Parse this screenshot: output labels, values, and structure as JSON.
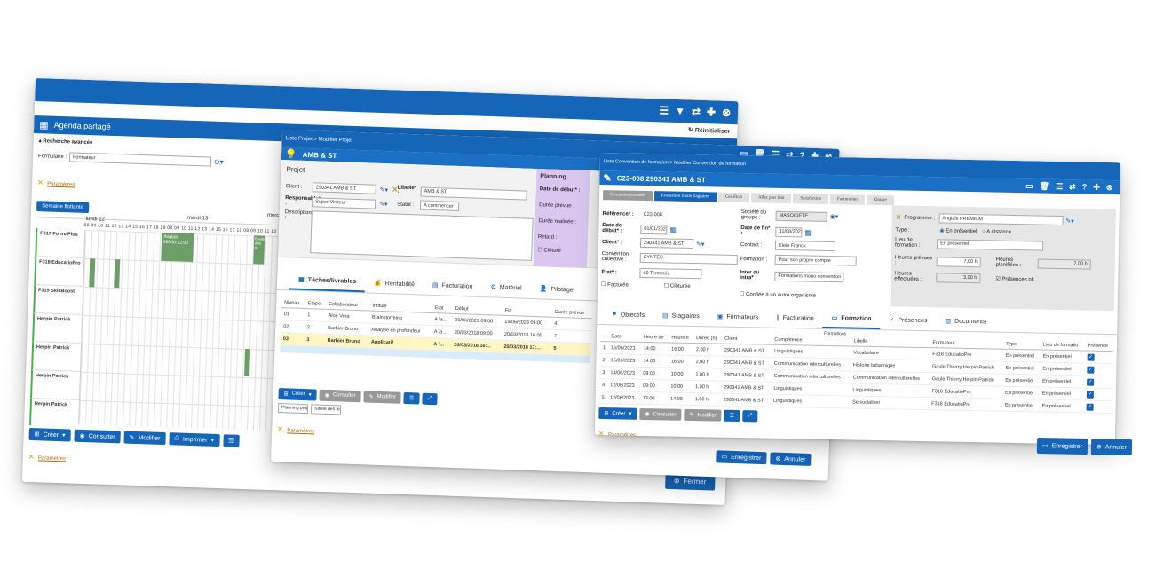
{
  "agenda": {
    "title": "Agenda partagé",
    "reset_label": "Réinitialiser",
    "advanced_search": "Recherche avancée",
    "form_label": "Formulaire :",
    "form_value": "Formateur",
    "params_label": "Paramètres",
    "week_btn": "Semaine flottante",
    "days": [
      "lundi 12",
      "mardi 13",
      "merc"
    ],
    "hours": "08 09 10 11 12 13 14 15 16 17 18 19 08 09 10 11 12 13 14 15 16 17 18 08 09 10 11 12",
    "rows": [
      "F317 FormaPlus",
      "F318 EducatioPro",
      "F319 SkillBoost",
      "Herpin Patrick",
      "Herpin Patrick",
      "Herpin Patrick",
      "Herpin Patrick"
    ],
    "event1": "Anglais 08h00-12:00",
    "event2": "Evalu atio n",
    "buttons": [
      "Créer",
      "Consulter",
      "Modifier",
      "Imprimer"
    ],
    "close_label": "Fermer"
  },
  "projet": {
    "breadcrumb": "Liste Projet > Modifier Projet",
    "title": "AMB & ST",
    "section": "Projet",
    "client_label": "Client :",
    "client_value": "290341 AMB & ST",
    "libelle_label": "Libellé* :",
    "libelle_value": "AMB & ST",
    "resp_label": "Responsable* :",
    "resp_value": "Super Visiteur",
    "statut_label": "Statut :",
    "statut_value": "A commencer",
    "desc_label": "Description :",
    "planning_title": "Planning",
    "date_debut_label": "Date de début* :",
    "date_debut_value": "09/06/2",
    "duree_prevue": "Durée prévue :",
    "duree_realisee": "Durée réalisée :",
    "retard": "Retard :",
    "cloture": "Clôturé",
    "tabs": [
      "Tâches/livrables",
      "Rentabilité",
      "Facturation",
      "Matériel",
      "Pilotage"
    ],
    "a_faire": "A faire",
    "cols": [
      "Niveau",
      "Etape",
      "Collaborateur",
      "Intitulé",
      "Etat",
      "Début",
      "Fin",
      "Durée prévue"
    ],
    "rows": [
      [
        "01",
        "1",
        "Aloé Vera",
        "Brainstorming",
        "A fa...",
        "09/06/2023 09:00",
        "19/06/2023 09:00",
        "4"
      ],
      [
        "02",
        "2",
        "Barbier Bruno",
        "Analyse en profondeur",
        "A fa...",
        "20/03/2018 09:00",
        "20/03/2018 16:00",
        "7"
      ],
      [
        "03",
        "3",
        "Barbier Bruno",
        "Applicatif",
        "A f...",
        "20/03/2018 16:...",
        "20/03/2018 17:...",
        "5"
      ]
    ],
    "buttons": [
      "Créer",
      "Consulter",
      "Modifier"
    ],
    "extra_buttons": [
      "Planning projet",
      "Saisie des temps"
    ],
    "params_label": "Paramètres",
    "save_label": "Enregistrer",
    "cancel_label": "Annuler"
  },
  "convention": {
    "breadcrumb": "Liste Convention de formation > Modifier Convention de formation",
    "title": "C23-008 290341 AMB & ST",
    "steps": [
      "Formation terminée",
      "Evaluation finale stagiaires",
      "Certificat",
      "Allez plus loin",
      "Satisfaction",
      "Facturation",
      "Cloture"
    ],
    "ref_label": "Référence* :",
    "ref_value": "C23-008",
    "date_debut_label": "Date de début* :",
    "date_debut_value": "01/01/2023",
    "client_label": "Client* :",
    "client_value": "290341 AMB & ST",
    "conv_label": "Convention collective :",
    "conv_value": "SYNTEC",
    "etat_label": "État* :",
    "etat_value": "60 Terminée",
    "facturee": "Facturée",
    "cloturee": "Clôturée",
    "societe_label": "Société du groupe :",
    "societe_value": "MASOCIETE",
    "date_fin_label": "Date de fin* :",
    "date_fin_value": "31/08/2023",
    "contact_label": "Contact :",
    "contact_value": "Klein Franck",
    "formation_label": "Formation :",
    "formation_value": "Pour son propre compte",
    "intra_label": "Inter ou intra* :",
    "intra_value": "Formations mono convention",
    "confiee": "Confiée à un autre organisme",
    "programme_label": "Programme :",
    "programme_value": "Anglais PREMIUM",
    "type_label": "Type :",
    "type_opt1": "En présentiel",
    "type_opt2": "A distance",
    "lieu_label": "Lieu de formation :",
    "lieu_value": "En présentiel",
    "heures_prevues_label": "Heures prévues :",
    "heures_prevues_value": "7,00 h",
    "heures_planif_label": "Heures planifiées :",
    "heures_planif_value": "7,00 h",
    "heures_eff_label": "Heures effectuées :",
    "heures_eff_value": "3,00 h",
    "presences_ok": "Présences ok",
    "tabs": [
      "Objectifs",
      "Stagiaires",
      "Formateurs",
      "Facturation",
      "Formation",
      "Présences",
      "Documents"
    ],
    "formations_caption": "Formations",
    "cols": [
      "Date",
      "Heure de",
      "Heure fi",
      "Durée (h)",
      "Client",
      "Compétence",
      "Libellé",
      "Formateur",
      "Type",
      "Lieu de formatio",
      "Présence"
    ],
    "rows": [
      [
        "1",
        "16/06/2023",
        "14:00",
        "16:00",
        "2,00 h",
        "290341 AMB & ST",
        "Linguistiques",
        "Vocabulaire",
        "F318 EducatioPro",
        "En présentiel",
        "En présentiel"
      ],
      [
        "2",
        "15/06/2023",
        "14:00",
        "16:00",
        "2,00 h",
        "290341 AMB & ST",
        "Communication interculturelles",
        "Histoire britannique",
        "Gaule Thierry Herpin Patrick",
        "En présentiel",
        "En présentiel"
      ],
      [
        "3",
        "14/06/2023",
        "09:00",
        "10:00",
        "1,00 h",
        "290341 AMB & ST",
        "Communication interculturelles",
        "Communication interculturelles",
        "Gaule Thierry Herpin Patrick",
        "En présentiel",
        "En présentiel"
      ],
      [
        "4",
        "12/06/2023",
        "09:00",
        "10:00",
        "1,00 h",
        "290341 AMB & ST",
        "Linguistiques",
        "Linguistiques",
        "F318 EducatioPro",
        "En présentiel",
        "En présentiel"
      ],
      [
        "5",
        "12/06/2023",
        "13:00",
        "14:00",
        "1,00 h",
        "290341 AMB & ST",
        "Linguistiques",
        "Se socialiser",
        "F318 EducatioPro",
        "En présentiel",
        "En présentiel"
      ]
    ],
    "buttons": [
      "Créer",
      "Consulter",
      "Modifier"
    ],
    "params_label": "Paramètres",
    "save_label": "Enregistrer",
    "cancel_label": "Annuler"
  }
}
